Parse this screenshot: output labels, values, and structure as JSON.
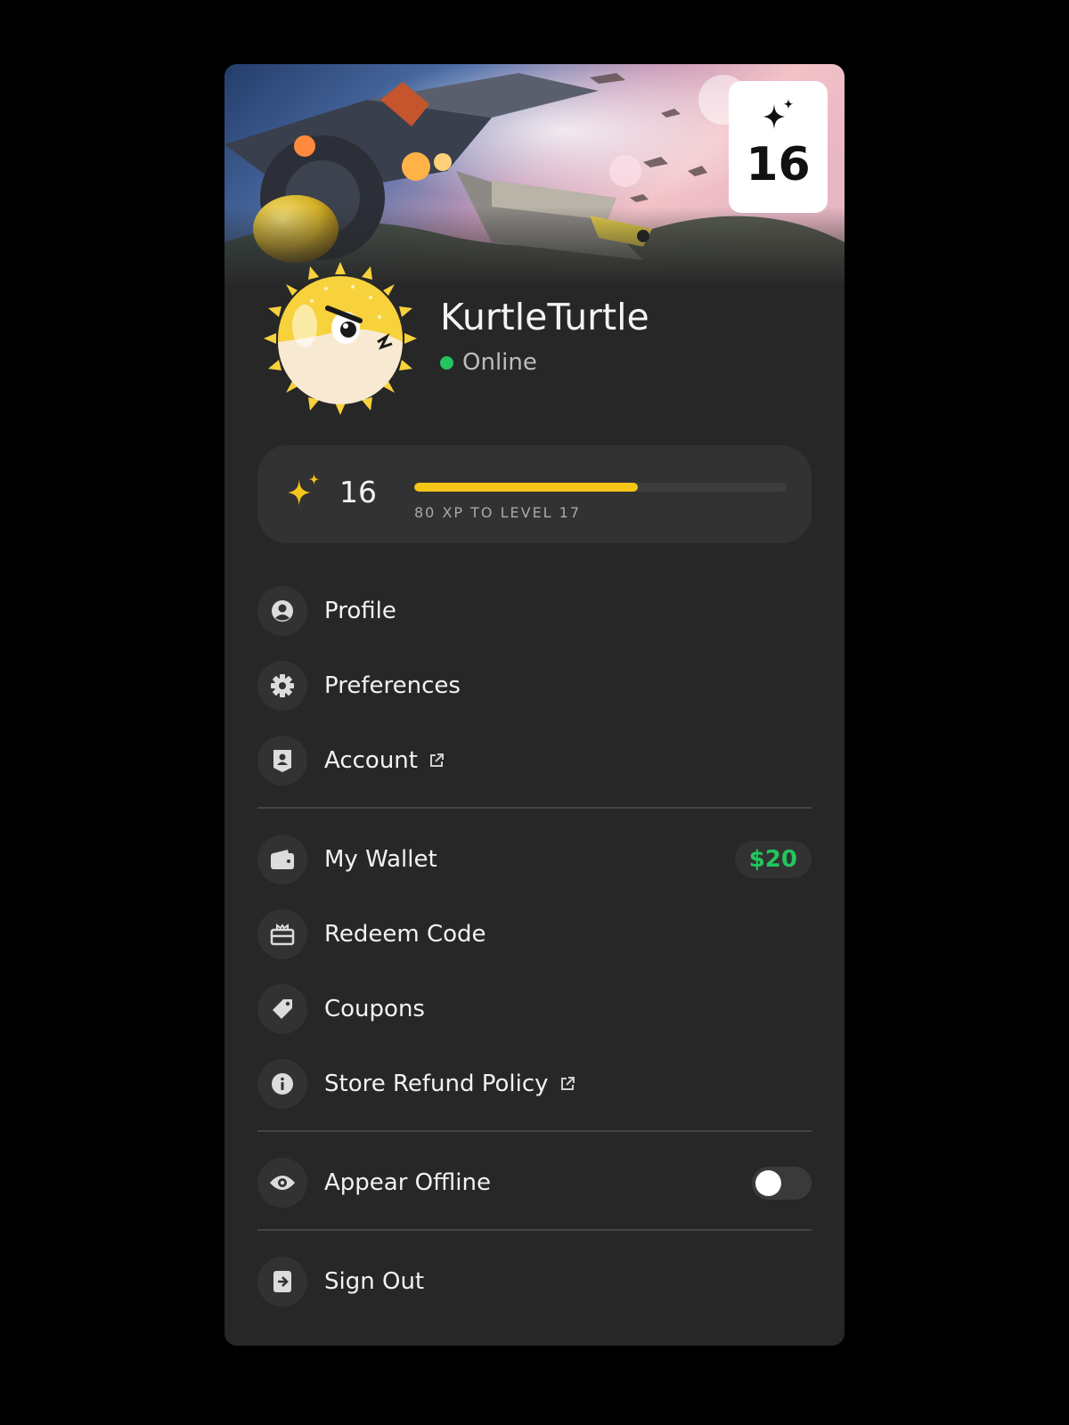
{
  "profile": {
    "username": "KurtleTurtle",
    "status": "Online",
    "level": "16"
  },
  "xp": {
    "level": "16",
    "caption": "80 XP TO LEVEL 17",
    "progress_percent": 60
  },
  "menu": {
    "profile": "Profile",
    "preferences": "Preferences",
    "account": "Account",
    "wallet": "My Wallet",
    "wallet_balance": "$20",
    "redeem": "Redeem Code",
    "coupons": "Coupons",
    "refund": "Store Refund Policy",
    "appear_offline": "Appear Offline",
    "appear_offline_enabled": false,
    "sign_out": "Sign Out"
  },
  "icons": {
    "profile": "user-circle-icon",
    "preferences": "gear-icon",
    "account": "id-badge-icon",
    "wallet": "wallet-icon",
    "redeem": "gift-card-icon",
    "coupons": "tag-icon",
    "refund": "info-icon",
    "appear_offline": "eye-icon",
    "sign_out": "sign-out-icon",
    "external": "external-link-icon",
    "level": "sparkle-icon"
  },
  "colors": {
    "accent_yellow": "#f5c518",
    "online_green": "#22c55e",
    "wallet_green": "#22c55e",
    "panel_bg": "#272727"
  }
}
